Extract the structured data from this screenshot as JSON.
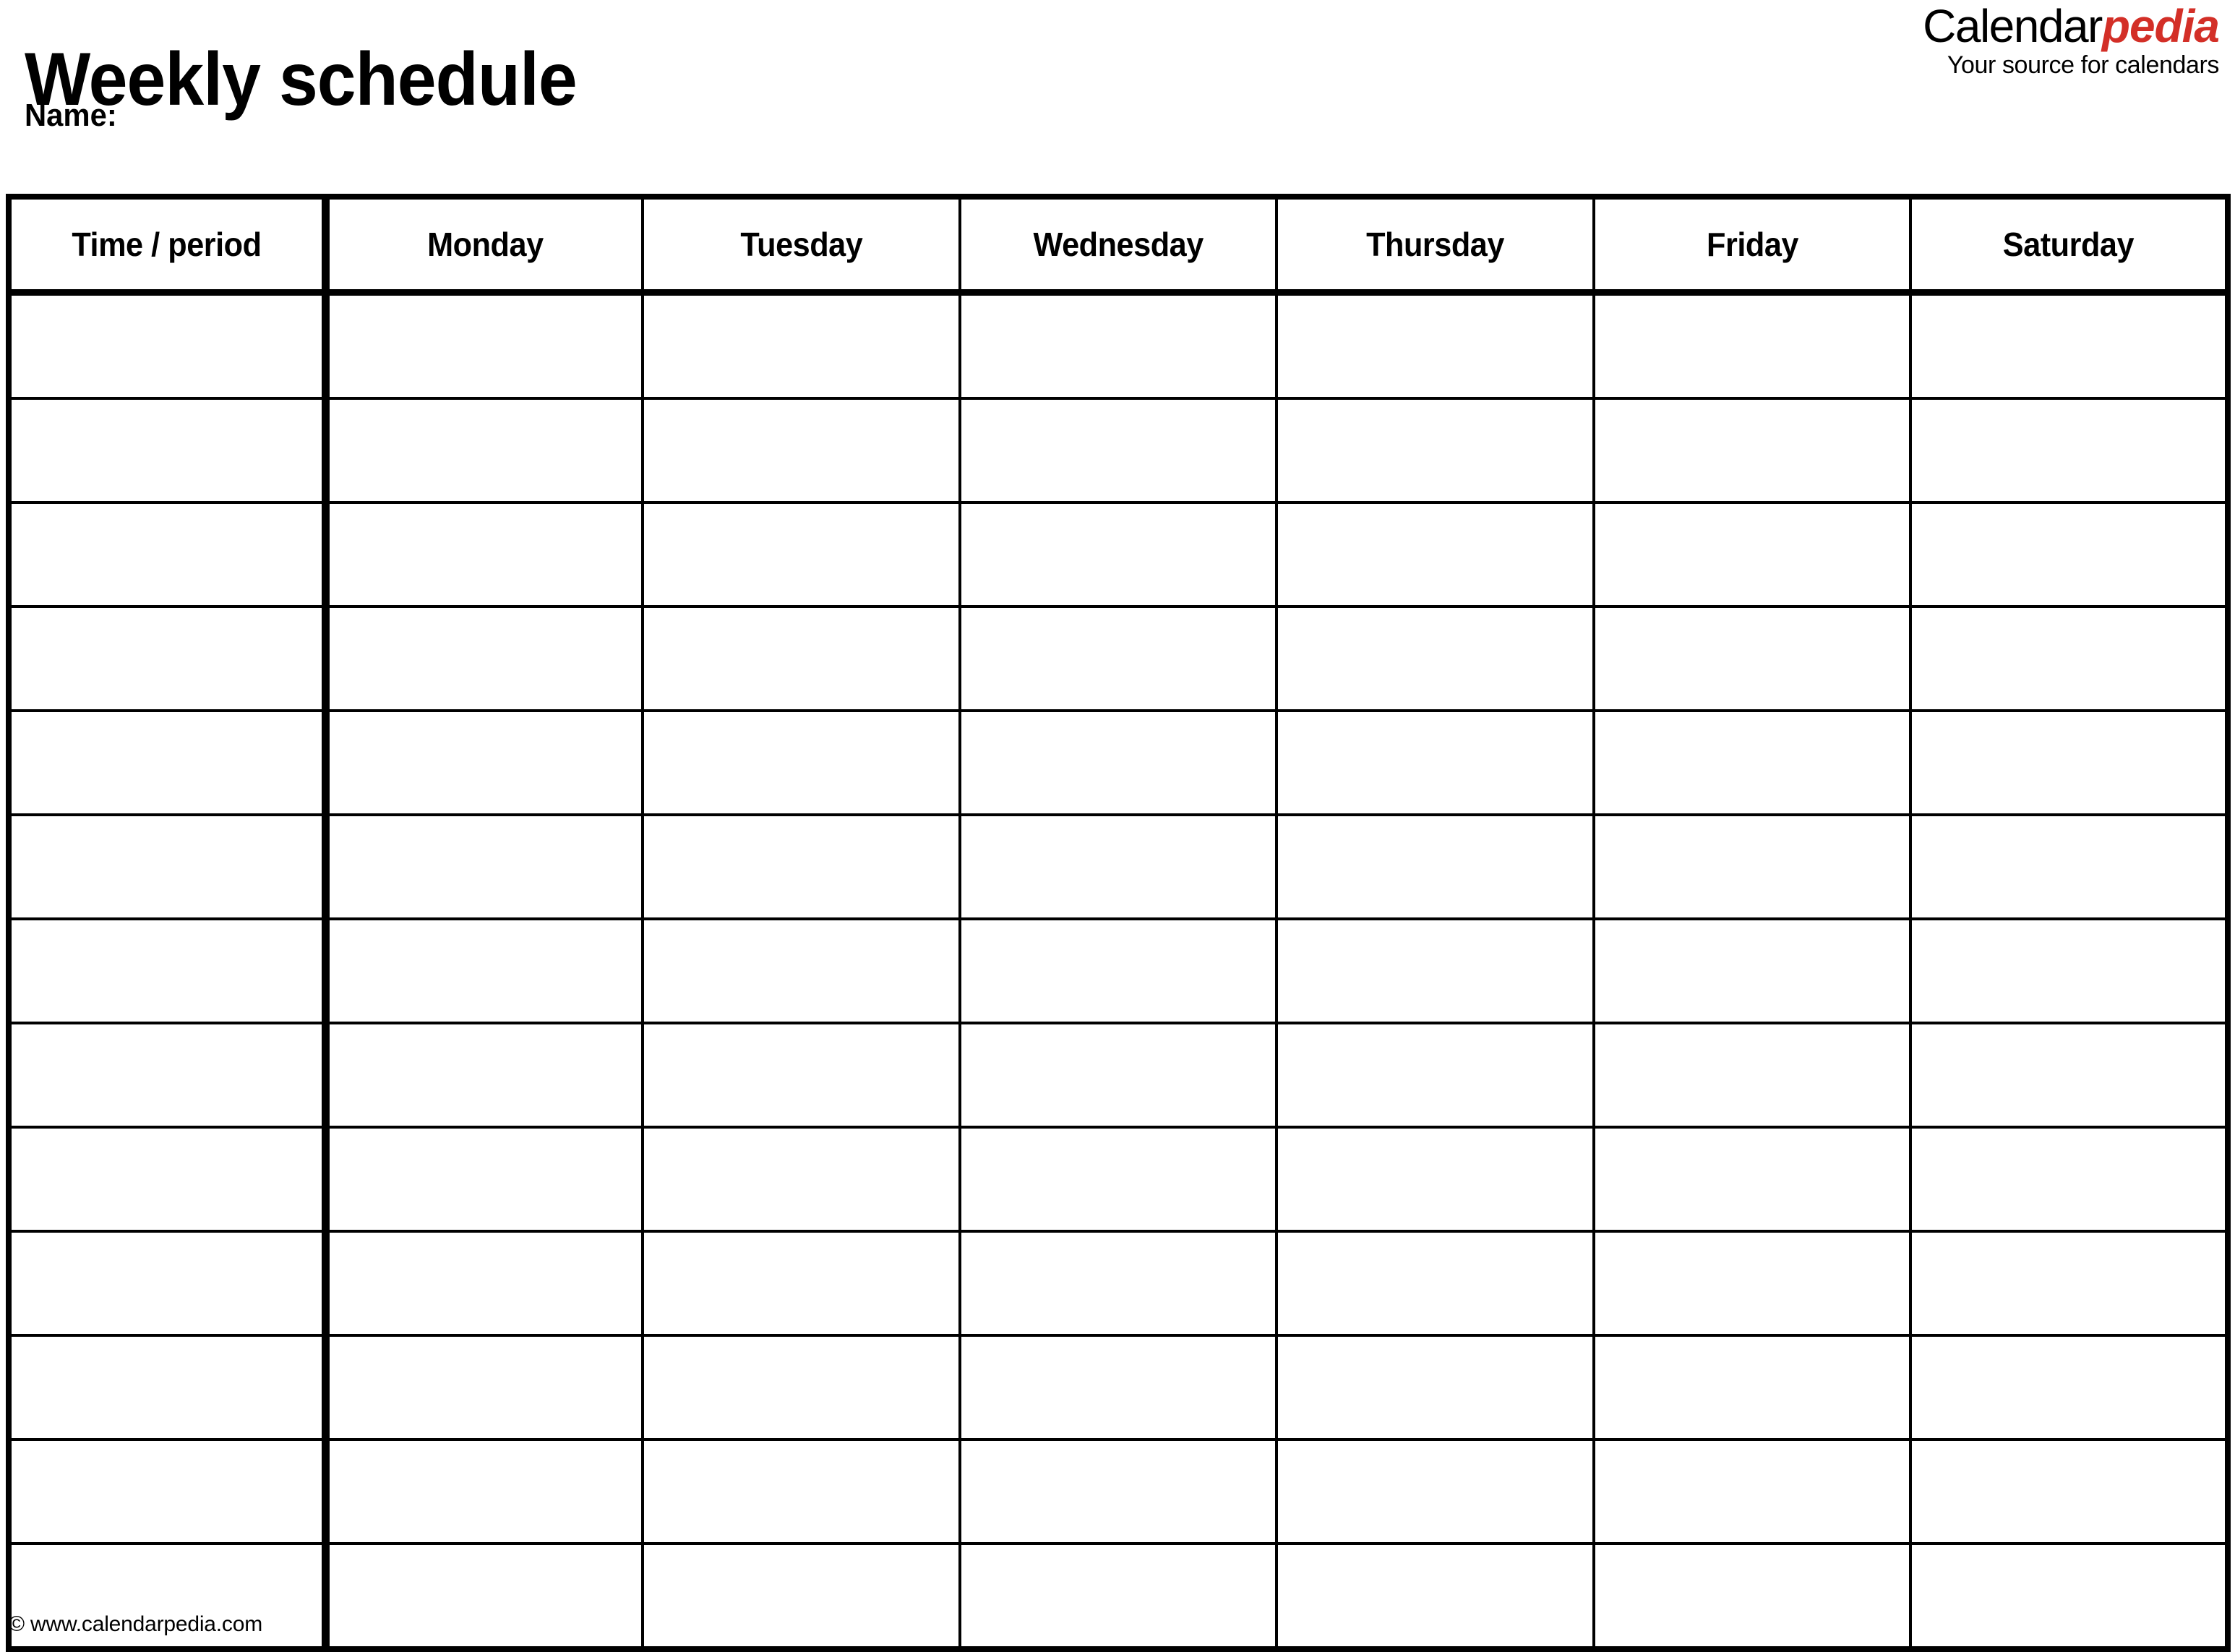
{
  "header": {
    "title": "Weekly schedule",
    "name_label": "Name:"
  },
  "brand": {
    "word_part_1": "Calendar",
    "word_part_2": "pedia",
    "tagline": "Your source for calendars",
    "accent_color": "#D32F27"
  },
  "table": {
    "columns": [
      {
        "key": "time",
        "label": "Time / period"
      },
      {
        "key": "monday",
        "label": "Monday"
      },
      {
        "key": "tuesday",
        "label": "Tuesday"
      },
      {
        "key": "wednesday",
        "label": "Wednesday"
      },
      {
        "key": "thursday",
        "label": "Thursday"
      },
      {
        "key": "friday",
        "label": "Friday"
      },
      {
        "key": "saturday",
        "label": "Saturday"
      }
    ],
    "row_count": 13,
    "rows": [
      {
        "time": "",
        "monday": "",
        "tuesday": "",
        "wednesday": "",
        "thursday": "",
        "friday": "",
        "saturday": ""
      },
      {
        "time": "",
        "monday": "",
        "tuesday": "",
        "wednesday": "",
        "thursday": "",
        "friday": "",
        "saturday": ""
      },
      {
        "time": "",
        "monday": "",
        "tuesday": "",
        "wednesday": "",
        "thursday": "",
        "friday": "",
        "saturday": ""
      },
      {
        "time": "",
        "monday": "",
        "tuesday": "",
        "wednesday": "",
        "thursday": "",
        "friday": "",
        "saturday": ""
      },
      {
        "time": "",
        "monday": "",
        "tuesday": "",
        "wednesday": "",
        "thursday": "",
        "friday": "",
        "saturday": ""
      },
      {
        "time": "",
        "monday": "",
        "tuesday": "",
        "wednesday": "",
        "thursday": "",
        "friday": "",
        "saturday": ""
      },
      {
        "time": "",
        "monday": "",
        "tuesday": "",
        "wednesday": "",
        "thursday": "",
        "friday": "",
        "saturday": ""
      },
      {
        "time": "",
        "monday": "",
        "tuesday": "",
        "wednesday": "",
        "thursday": "",
        "friday": "",
        "saturday": ""
      },
      {
        "time": "",
        "monday": "",
        "tuesday": "",
        "wednesday": "",
        "thursday": "",
        "friday": "",
        "saturday": ""
      },
      {
        "time": "",
        "monday": "",
        "tuesday": "",
        "wednesday": "",
        "thursday": "",
        "friday": "",
        "saturday": ""
      },
      {
        "time": "",
        "monday": "",
        "tuesday": "",
        "wednesday": "",
        "thursday": "",
        "friday": "",
        "saturday": ""
      },
      {
        "time": "",
        "monday": "",
        "tuesday": "",
        "wednesday": "",
        "thursday": "",
        "friday": "",
        "saturday": ""
      },
      {
        "time": "",
        "monday": "",
        "tuesday": "",
        "wednesday": "",
        "thursday": "",
        "friday": "",
        "saturday": ""
      }
    ]
  },
  "footer": {
    "credit": "© www.calendarpedia.com"
  }
}
